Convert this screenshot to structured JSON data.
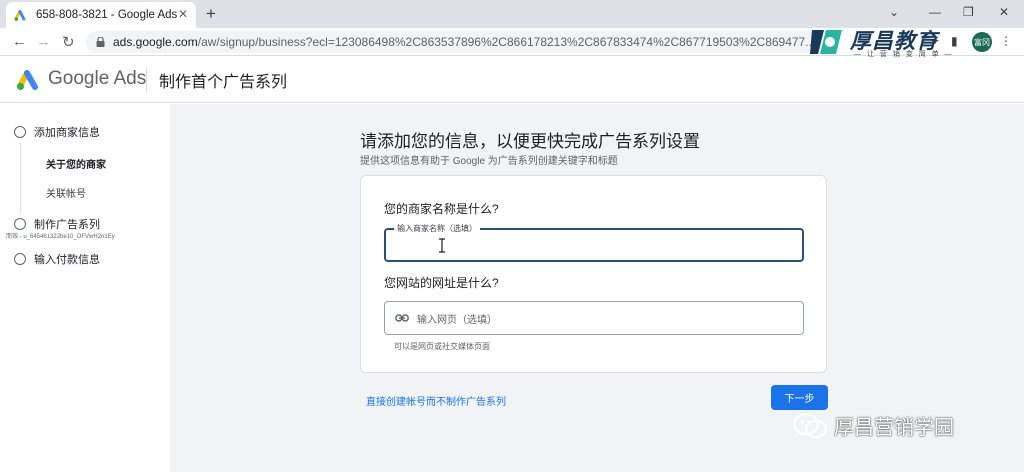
{
  "browser": {
    "tab_title": "658-808-3821 - Google Ads",
    "new_tab_symbol": "+",
    "url_host": "ads.google.com",
    "url_rest": "/aw/signup/business?ecl=123086498%2C863537896%2C866178213%2C867833474%2C867719503%2C869477...",
    "avatar_text": "富冈"
  },
  "watermark": {
    "title": "厚昌教育",
    "subtitle": "— 让 营 销 变 简 单 —",
    "bottom": "厚昌营销学园"
  },
  "header": {
    "brand": "Google Ads",
    "title": "制作首个广告系列"
  },
  "sidebar": {
    "steps": [
      {
        "label": "添加商家信息"
      },
      {
        "label": "制作广告系列"
      },
      {
        "label": "输入付款信息"
      }
    ],
    "substeps": [
      {
        "label": "关于您的商家"
      },
      {
        "label": "关联帐号"
      }
    ],
    "tiny_text": "而效 - u_645461322be10_OFVwH2n1Ey"
  },
  "main": {
    "title": "请添加您的信息，以便更快完成广告系列设置",
    "subtitle": "提供这项信息有助于 Google 为广告系列创建关键字和标题",
    "q1": "您的商家名称是什么?",
    "q1_label": "输入商家名称（选填）",
    "q2": "您网站的网址是什么?",
    "q2_placeholder": "输入网页（选填）",
    "q2_help": "可以是网页或社交媒体页面",
    "skip_link": "直接创建帐号而不制作广告系列",
    "next_button": "下一步"
  },
  "colors": {
    "primary": "#1a73e8",
    "focus_border": "#2a4f7a",
    "main_bg": "#f1f3f4"
  }
}
